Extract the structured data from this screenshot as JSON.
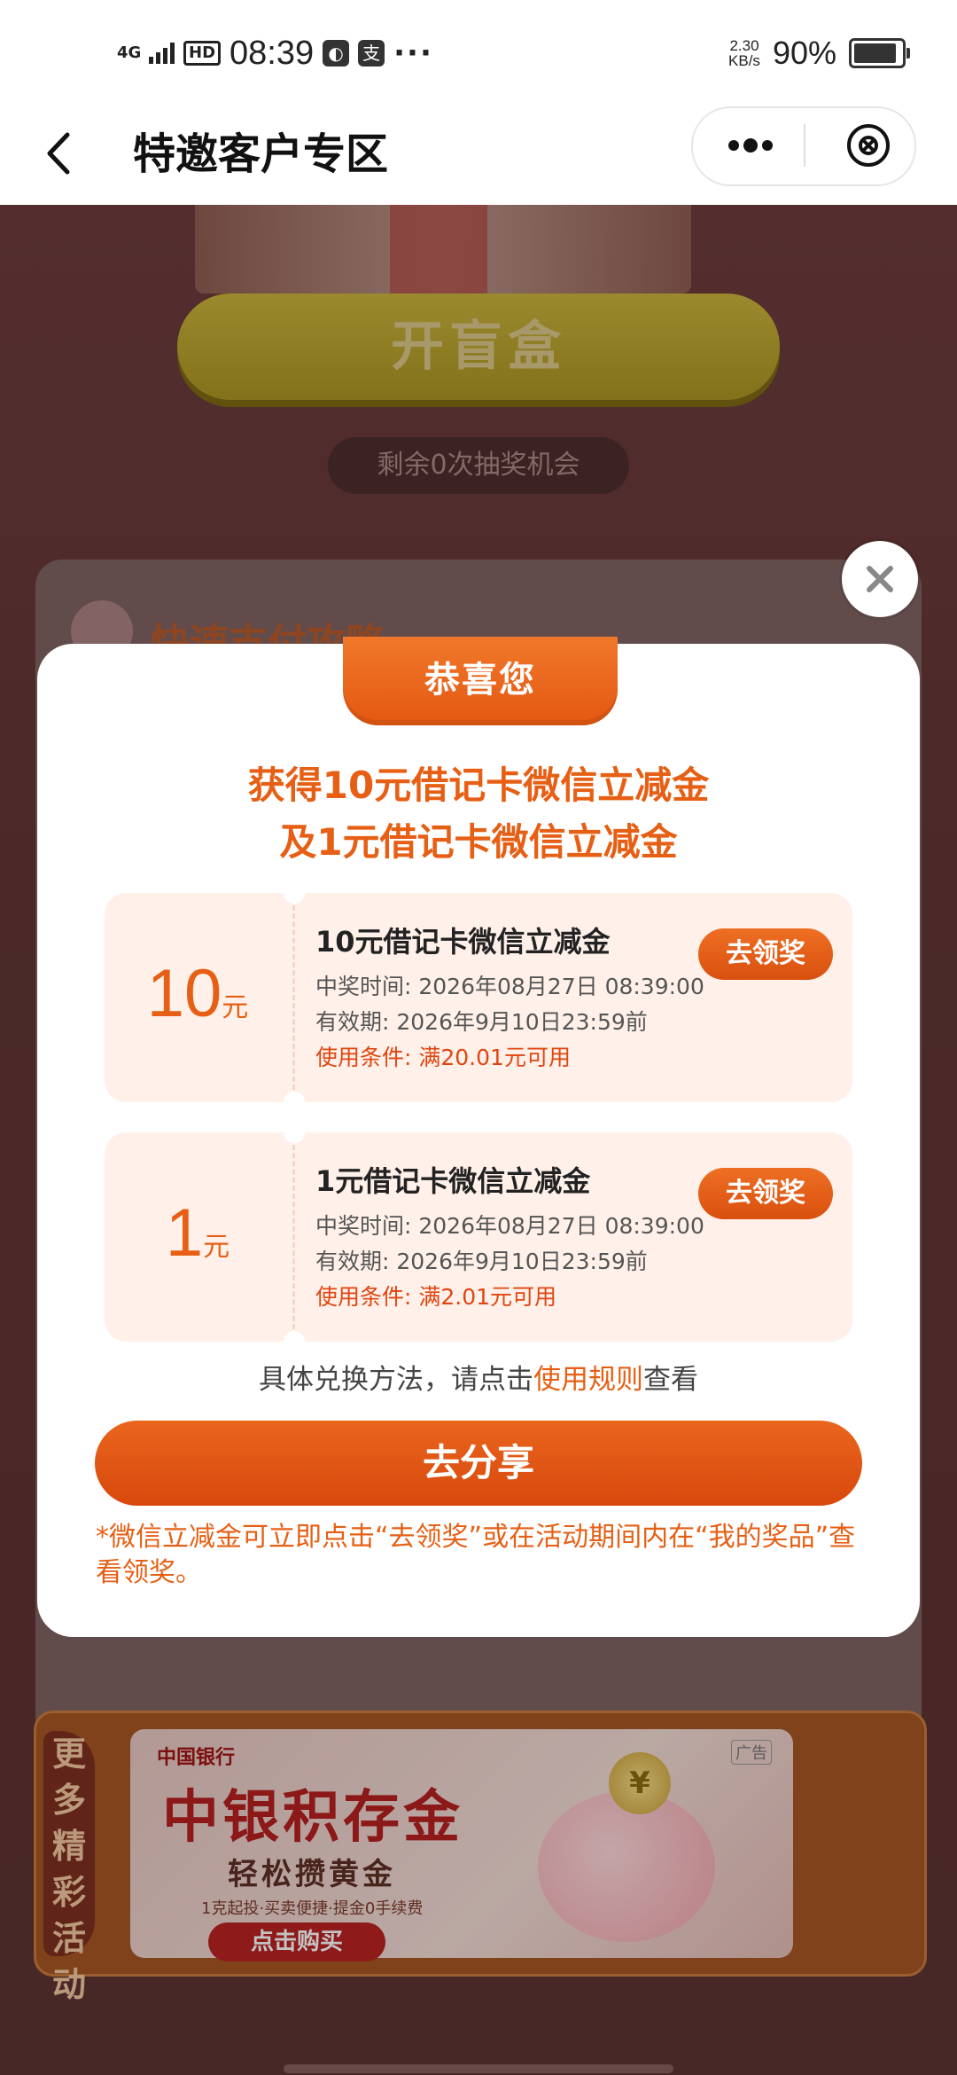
{
  "status_bar": {
    "network": "4G",
    "hd": "HD",
    "time": "08:39",
    "more": "···",
    "speed_value": "2.30",
    "speed_unit": "KB/s",
    "battery_percent": "90%",
    "battery_level": 0.9
  },
  "nav": {
    "title": "特邀客户专区"
  },
  "background": {
    "open_box_label": "开盲盒",
    "chances_text": "剩余0次抽奖机会",
    "panel_title": "快速支付攻略",
    "promo_side_label": "更多精彩活动",
    "ad": {
      "bank_logo": "中国银行",
      "tag": "广告",
      "title": "中银积存金",
      "subtitle": "轻松攒黄金",
      "note": "1克起投·买卖便捷·提金0手续费",
      "cta": "点击购买"
    }
  },
  "modal": {
    "badge": "恭喜您",
    "headline_line1": "获得10元借记卡微信立减金",
    "headline_line2": "及1元借记卡微信立减金",
    "coupons": [
      {
        "amount": "10",
        "unit": "元",
        "title": "10元借记卡微信立减金",
        "win_time": "中奖时间: 2026年08月27日 08:39:00",
        "validity": "有效期: 2026年9月10日23:59前",
        "condition": "使用条件: 满20.01元可用",
        "claim_label": "去领奖"
      },
      {
        "amount": "1",
        "unit": "元",
        "title": "1元借记卡微信立减金",
        "win_time": "中奖时间: 2026年08月27日 08:39:00",
        "validity": "有效期: 2026年9月10日23:59前",
        "condition": "使用条件: 满2.01元可用",
        "claim_label": "去领奖"
      }
    ],
    "howto_prefix": "具体兑换方法，请点击",
    "howto_link": "使用规则",
    "howto_suffix": "查看",
    "share_label": "去分享",
    "footnote": "*微信立减金可立即点击“去领奖”或在活动期间内在“我的奖品”查看领奖。"
  },
  "colors": {
    "accent_orange": "#e65f14",
    "coupon_bg": "#fff1ea"
  }
}
